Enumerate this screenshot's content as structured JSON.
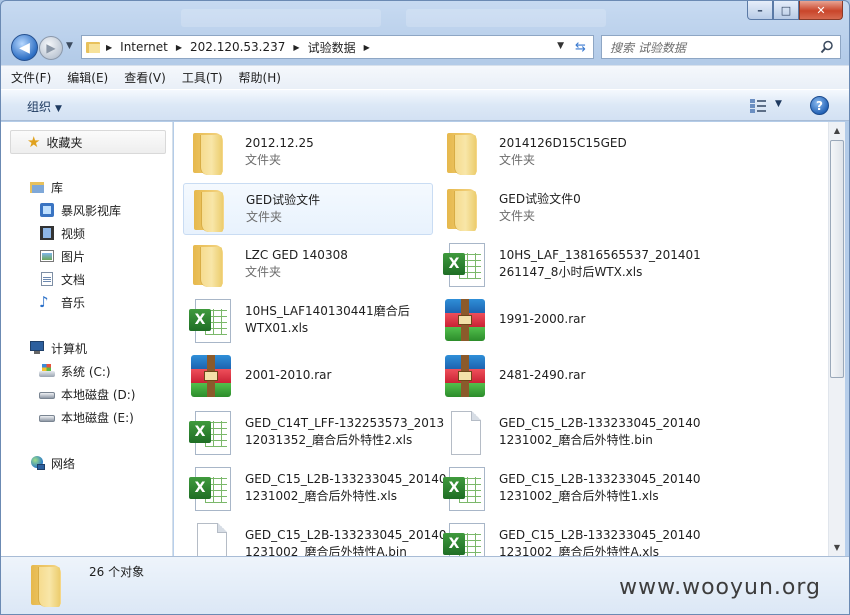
{
  "window": {
    "controls": {
      "minimize": "–",
      "maximize": "□",
      "close": "✕"
    }
  },
  "nav": {
    "back": "◀",
    "forward": "▶",
    "address": [
      "Internet",
      "202.120.53.237",
      "试验数据"
    ],
    "search_placeholder": "搜索 试验数据"
  },
  "menu": [
    "文件(F)",
    "编辑(E)",
    "查看(V)",
    "工具(T)",
    "帮助(H)"
  ],
  "toolbar": {
    "organize": "组织",
    "help": "?"
  },
  "sidebar": {
    "favorites": "收藏夹",
    "libraries": "库",
    "library_items": [
      "暴风影视库",
      "视频",
      "图片",
      "文档",
      "音乐"
    ],
    "computer": "计算机",
    "drives": [
      "系统 (C:)",
      "本地磁盘 (D:)",
      "本地磁盘 (E:)"
    ],
    "network": "网络"
  },
  "files": [
    {
      "type": "folder",
      "line1": "2012.12.25",
      "line2": "文件夹"
    },
    {
      "type": "folder",
      "line1": "2014126D15C15GED",
      "line2": "文件夹"
    },
    {
      "type": "folder",
      "line1": "GED试验文件",
      "line2": "文件夹",
      "selected": true
    },
    {
      "type": "folder",
      "line1": "GED试验文件0",
      "line2": "文件夹"
    },
    {
      "type": "folder",
      "line1": "LZC GED 140308",
      "line2": "文件夹"
    },
    {
      "type": "excel",
      "line1": "10HS_LAF_13816565537_201401",
      "line2": "261147_8小时后WTX.xls"
    },
    {
      "type": "excel",
      "line1": "10HS_LAF140130441磨合后",
      "line2": "WTX01.xls"
    },
    {
      "type": "rar",
      "line1": "1991-2000.rar",
      "line2": ""
    },
    {
      "type": "rar",
      "line1": "2001-2010.rar",
      "line2": ""
    },
    {
      "type": "rar",
      "line1": "2481-2490.rar",
      "line2": ""
    },
    {
      "type": "excel",
      "line1": "GED_C14T_LFF-132253573_2013",
      "line2": "12031352_磨合后外特性2.xls"
    },
    {
      "type": "blank",
      "line1": "GED_C15_L2B-133233045_20140",
      "line2": "1231002_磨合后外特性.bin"
    },
    {
      "type": "excel",
      "line1": "GED_C15_L2B-133233045_20140",
      "line2": "1231002_磨合后外特性.xls"
    },
    {
      "type": "excel",
      "line1": "GED_C15_L2B-133233045_20140",
      "line2": "1231002_磨合后外特性1.xls"
    },
    {
      "type": "blank",
      "line1": "GED_C15_L2B-133233045_20140",
      "line2": "1231002_磨合后外特性A.bin"
    },
    {
      "type": "excel",
      "line1": "GED_C15_L2B-133233045_20140",
      "line2": "1231002_磨合后外特性A.xls"
    }
  ],
  "status": {
    "count": "26 个对象"
  },
  "watermark": "www.wooyun.org"
}
